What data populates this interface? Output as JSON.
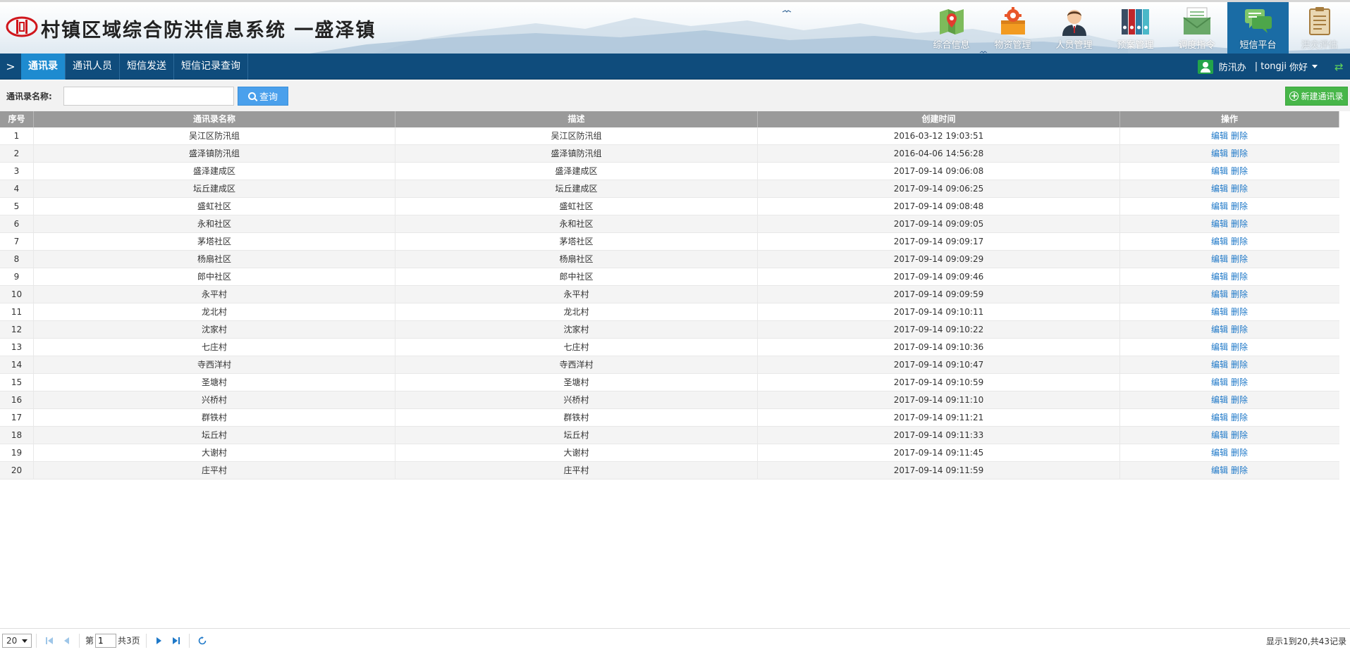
{
  "header": {
    "title": "村镇区域综合防洪信息系统 一盛泽镇",
    "nav": [
      {
        "label": "综合信息",
        "icon": "map-pin-icon"
      },
      {
        "label": "物资管理",
        "icon": "package-gear-icon"
      },
      {
        "label": "人员管理",
        "icon": "person-icon"
      },
      {
        "label": "预案管理",
        "icon": "binders-icon"
      },
      {
        "label": "调度指令",
        "icon": "envelope-icon"
      },
      {
        "label": "短信平台",
        "icon": "chat-bubbles-icon",
        "active": true
      },
      {
        "label": "洪灾评估",
        "icon": "clipboard-icon"
      }
    ]
  },
  "subnav": {
    "toggle": ">",
    "tabs": [
      "通讯录",
      "通讯人员",
      "短信发送",
      "短信记录查询"
    ],
    "active_tab": "通讯录",
    "user": {
      "dept": "防汛办",
      "name": "| tongji",
      "greeting": "你好"
    }
  },
  "toolbar": {
    "search_label": "通讯录名称:",
    "search_value": "",
    "query_label": "查询",
    "new_label": "新建通讯录"
  },
  "table": {
    "columns": [
      "序号",
      "通讯录名称",
      "描述",
      "创建时间",
      "操作"
    ],
    "edit_label": "编辑",
    "delete_label": "删除",
    "rows": [
      [
        "1",
        "吴江区防汛组",
        "吴江区防汛组",
        "2016-03-12 19:03:51"
      ],
      [
        "2",
        "盛泽镇防汛组",
        "盛泽镇防汛组",
        "2016-04-06 14:56:28"
      ],
      [
        "3",
        "盛泽建成区",
        "盛泽建成区",
        "2017-09-14 09:06:08"
      ],
      [
        "4",
        "坛丘建成区",
        "坛丘建成区",
        "2017-09-14 09:06:25"
      ],
      [
        "5",
        "盛虹社区",
        "盛虹社区",
        "2017-09-14 09:08:48"
      ],
      [
        "6",
        "永和社区",
        "永和社区",
        "2017-09-14 09:09:05"
      ],
      [
        "7",
        "茅塔社区",
        "茅塔社区",
        "2017-09-14 09:09:17"
      ],
      [
        "8",
        "杨扇社区",
        "杨扇社区",
        "2017-09-14 09:09:29"
      ],
      [
        "9",
        "郎中社区",
        "郎中社区",
        "2017-09-14 09:09:46"
      ],
      [
        "10",
        "永平村",
        "永平村",
        "2017-09-14 09:09:59"
      ],
      [
        "11",
        "龙北村",
        "龙北村",
        "2017-09-14 09:10:11"
      ],
      [
        "12",
        "沈家村",
        "沈家村",
        "2017-09-14 09:10:22"
      ],
      [
        "13",
        "七庄村",
        "七庄村",
        "2017-09-14 09:10:36"
      ],
      [
        "14",
        "寺西洋村",
        "寺西洋村",
        "2017-09-14 09:10:47"
      ],
      [
        "15",
        "圣塘村",
        "圣塘村",
        "2017-09-14 09:10:59"
      ],
      [
        "16",
        "兴桥村",
        "兴桥村",
        "2017-09-14 09:11:10"
      ],
      [
        "17",
        "群铁村",
        "群铁村",
        "2017-09-14 09:11:21"
      ],
      [
        "18",
        "坛丘村",
        "坛丘村",
        "2017-09-14 09:11:33"
      ],
      [
        "19",
        "大谢村",
        "大谢村",
        "2017-09-14 09:11:45"
      ],
      [
        "20",
        "庄平村",
        "庄平村",
        "2017-09-14 09:11:59"
      ]
    ]
  },
  "pager": {
    "page_size": "20",
    "page_prefix": "第",
    "current_page": "1",
    "page_suffix": "共3页",
    "info": "显示1到20,共43记录"
  },
  "colors": {
    "subnav_bg": "#0f4c7c",
    "active_tab": "#1e8bd0",
    "active_nav": "#1a6ca5",
    "query_button": "#4aa0ec",
    "new_button": "#47b649",
    "link": "#1e78c8",
    "table_header": "#9a9a9a"
  }
}
